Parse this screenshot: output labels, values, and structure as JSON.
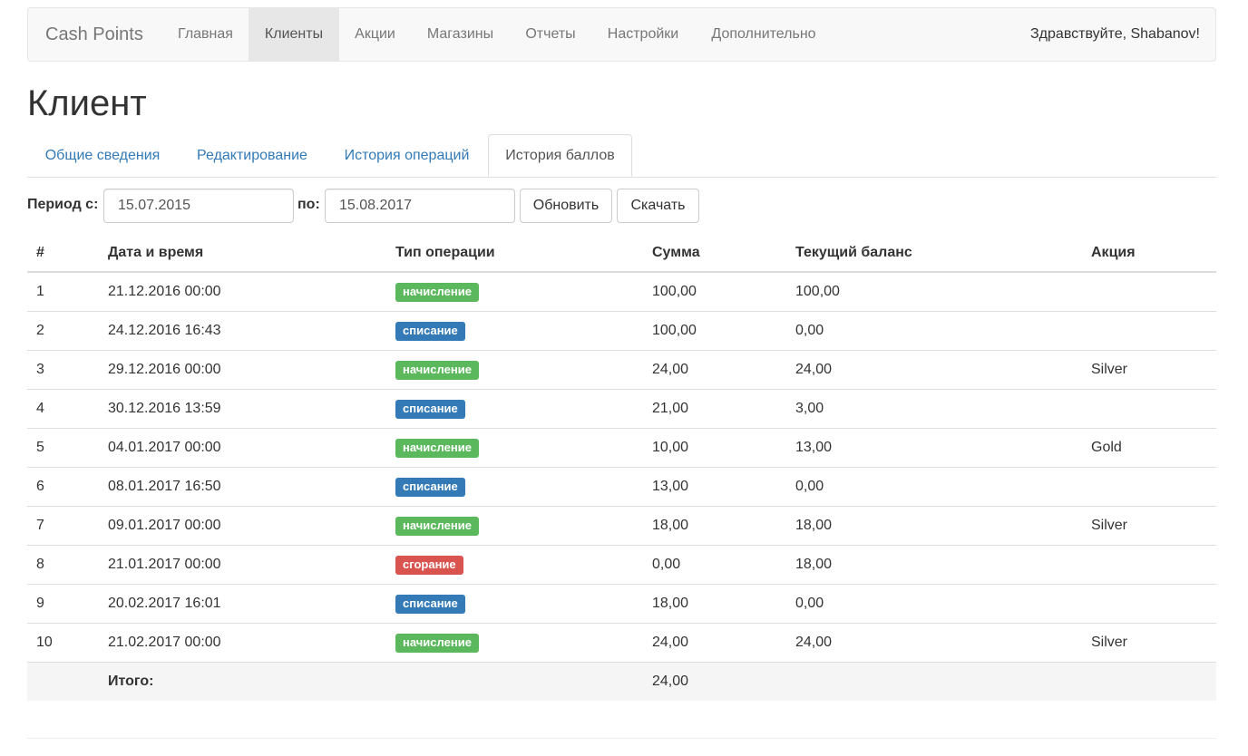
{
  "navbar": {
    "brand": "Cash Points",
    "items": [
      {
        "label": "Главная",
        "active": false
      },
      {
        "label": "Клиенты",
        "active": true
      },
      {
        "label": "Акции",
        "active": false
      },
      {
        "label": "Магазины",
        "active": false
      },
      {
        "label": "Отчеты",
        "active": false
      },
      {
        "label": "Настройки",
        "active": false
      },
      {
        "label": "Дополнительно",
        "active": false
      }
    ],
    "greeting": "Здравствуйте, Shabanov!"
  },
  "page": {
    "title": "Клиент"
  },
  "tabs": [
    {
      "label": "Общие сведения",
      "active": false
    },
    {
      "label": "Редактирование",
      "active": false
    },
    {
      "label": "История операций",
      "active": false
    },
    {
      "label": "История баллов",
      "active": true
    }
  ],
  "filter": {
    "from_label": "Период с:",
    "from_value": "15.07.2015",
    "to_label": "по:",
    "to_value": "15.08.2017",
    "refresh_label": "Обновить",
    "download_label": "Скачать"
  },
  "table": {
    "columns": [
      "#",
      "Дата и время",
      "Тип операции",
      "Сумма",
      "Текущий баланс",
      "Акция"
    ],
    "rows": [
      {
        "n": "1",
        "datetime": "21.12.2016 00:00",
        "type": "начисление",
        "kind": "accrual",
        "amount": "100,00",
        "balance": "100,00",
        "promo": ""
      },
      {
        "n": "2",
        "datetime": "24.12.2016 16:43",
        "type": "списание",
        "kind": "writeoff",
        "amount": "100,00",
        "balance": "0,00",
        "promo": ""
      },
      {
        "n": "3",
        "datetime": "29.12.2016 00:00",
        "type": "начисление",
        "kind": "accrual",
        "amount": "24,00",
        "balance": "24,00",
        "promo": "Silver"
      },
      {
        "n": "4",
        "datetime": "30.12.2016 13:59",
        "type": "списание",
        "kind": "writeoff",
        "amount": "21,00",
        "balance": "3,00",
        "promo": ""
      },
      {
        "n": "5",
        "datetime": "04.01.2017 00:00",
        "type": "начисление",
        "kind": "accrual",
        "amount": "10,00",
        "balance": "13,00",
        "promo": "Gold"
      },
      {
        "n": "6",
        "datetime": "08.01.2017 16:50",
        "type": "списание",
        "kind": "writeoff",
        "amount": "13,00",
        "balance": "0,00",
        "promo": ""
      },
      {
        "n": "7",
        "datetime": "09.01.2017 00:00",
        "type": "начисление",
        "kind": "accrual",
        "amount": "18,00",
        "balance": "18,00",
        "promo": "Silver"
      },
      {
        "n": "8",
        "datetime": "21.01.2017 00:00",
        "type": "сгорание",
        "kind": "expire",
        "amount": "0,00",
        "balance": "18,00",
        "promo": ""
      },
      {
        "n": "9",
        "datetime": "20.02.2017 16:01",
        "type": "списание",
        "kind": "writeoff",
        "amount": "18,00",
        "balance": "0,00",
        "promo": ""
      },
      {
        "n": "10",
        "datetime": "21.02.2017 00:00",
        "type": "начисление",
        "kind": "accrual",
        "amount": "24,00",
        "balance": "24,00",
        "promo": "Silver"
      }
    ],
    "total_label": "Итого:",
    "total_amount": "24,00"
  },
  "colors": {
    "accrual": "#5cb85c",
    "writeoff": "#337ab7",
    "expire": "#d9534f",
    "link": "#337ab7"
  }
}
